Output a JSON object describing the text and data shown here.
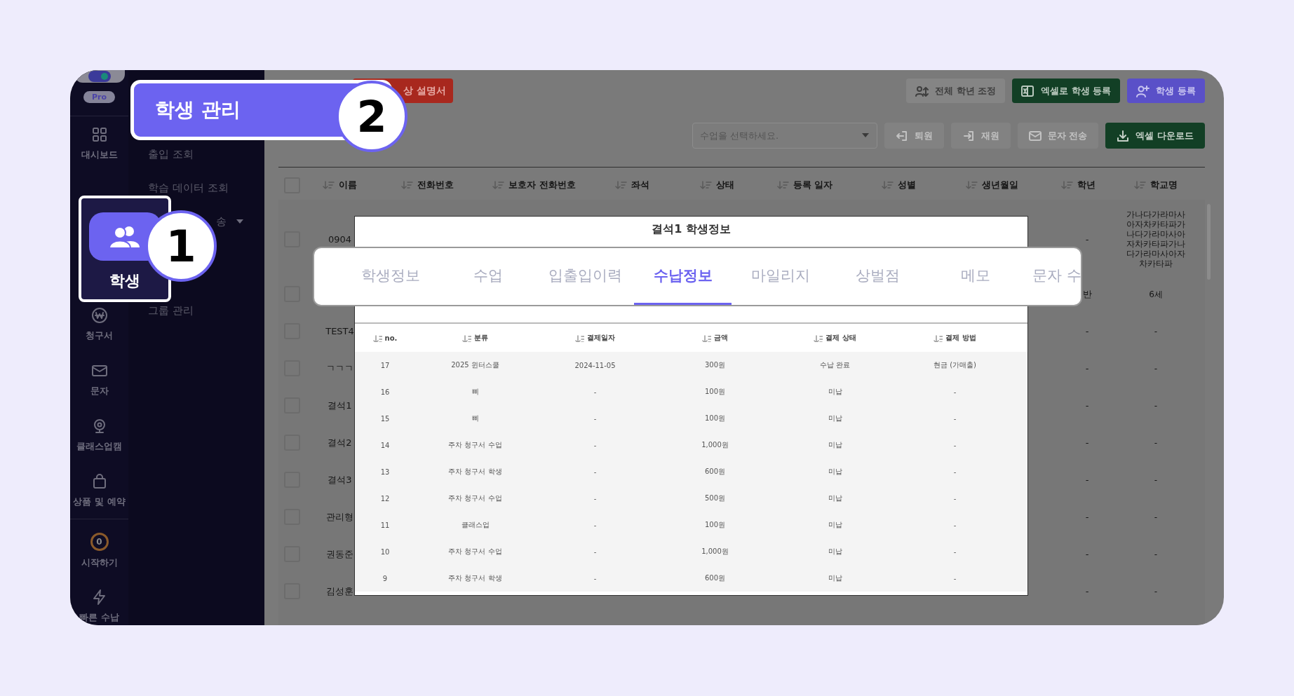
{
  "icon_sidebar": {
    "badge": "Pro",
    "items": [
      {
        "label": "대시보드",
        "kind": "grid"
      },
      {
        "label": "청구서",
        "kind": "won"
      },
      {
        "label": "문자",
        "kind": "mail"
      },
      {
        "label": "클래스업캠",
        "kind": "webcam"
      },
      {
        "label": "상품 및 예약",
        "kind": "bag"
      }
    ],
    "bottom_items": [
      {
        "label": "시작하기",
        "kind": "progress",
        "count": "0"
      },
      {
        "label": "빠른 수납",
        "kind": "bolt"
      }
    ]
  },
  "sub_sidebar": {
    "items": [
      {
        "label": "출입 조회",
        "expandable": false
      },
      {
        "label": "학습 데이터 조회",
        "expandable": false
      },
      {
        "label": "송",
        "expandable": true
      },
      {
        "label": "그룹 관리",
        "expandable": false
      }
    ]
  },
  "toolbar": {
    "guide_button": "상 설명서",
    "buttons": [
      {
        "label": "전체 학년 조정",
        "kind": "gray"
      },
      {
        "label": "엑셀로 학생 등록",
        "kind": "green"
      },
      {
        "label": "학생 등록",
        "kind": "purple"
      }
    ]
  },
  "filter_bar": {
    "class_select": {
      "placeholder": "수업을 선택하세요."
    },
    "buttons": [
      {
        "label": "퇴원",
        "disabled": true
      },
      {
        "label": "재원",
        "disabled": true
      },
      {
        "label": "문자 전송",
        "disabled": true
      },
      {
        "label": "엑셀 다운로드",
        "disabled": false
      }
    ]
  },
  "table": {
    "header_checked": false,
    "columns": [
      "이름",
      "전화번호",
      "보호자 전화번호",
      "좌석",
      "상태",
      "등록 일자",
      "성별",
      "생년월일",
      "학년",
      "학교명"
    ],
    "rows": [
      {
        "name": "0904",
        "grade": "-",
        "school": "가나다가라마사아자차카타파가나다가라마사아자차카타파가나다가라마사아자차카타파",
        "checked": false
      },
      {
        "grade": "반",
        "school": "6세",
        "checked": false
      },
      {
        "name": "TEST4",
        "grade": "-",
        "school": "-",
        "checked": false
      },
      {
        "name": "ㄱㄱㄱ",
        "grade": "-",
        "school": "-",
        "checked": false
      },
      {
        "name": "결석1",
        "grade": "-",
        "school": "-",
        "checked": false
      },
      {
        "name": "결석2",
        "grade": "-",
        "school": "-",
        "checked": false
      },
      {
        "name": "결석3",
        "grade": "-",
        "school": "-",
        "checked": false
      },
      {
        "name": "관리형",
        "grade": "-",
        "school": "-",
        "checked": false
      },
      {
        "name": "권동준",
        "grade": "-",
        "school": "-",
        "checked": false
      },
      {
        "name": "김성훈",
        "grade": "-",
        "school": "-",
        "checked": false
      }
    ]
  },
  "modal": {
    "title": "결석1 학생정보",
    "tabs": [
      {
        "label": "학생정보",
        "selected": false
      },
      {
        "label": "수업",
        "selected": false
      },
      {
        "label": "입출입이력",
        "selected": false
      },
      {
        "label": "수납정보",
        "selected": true
      },
      {
        "label": "마일리지",
        "selected": false
      },
      {
        "label": "상벌점",
        "selected": false
      },
      {
        "label": "메모",
        "selected": false
      },
      {
        "label": "문자 수",
        "selected": false
      }
    ],
    "table": {
      "columns": [
        "no.",
        "분류",
        "결제일자",
        "금액",
        "결제 상태",
        "결제 방법"
      ],
      "rows": [
        [
          "17",
          "2025 윈터스쿨",
          "2024-11-05",
          "300원",
          "수납 완료",
          "현금 (가매출)"
        ],
        [
          "16",
          "삐",
          "-",
          "100원",
          "미납",
          "-"
        ],
        [
          "15",
          "삐",
          "-",
          "100원",
          "미납",
          "-"
        ],
        [
          "14",
          "주차 청구서 수업",
          "-",
          "1,000원",
          "미납",
          "-"
        ],
        [
          "13",
          "주차 청구서 학생",
          "-",
          "600원",
          "미납",
          "-"
        ],
        [
          "12",
          "주차 청구서 수업",
          "-",
          "500원",
          "미납",
          "-"
        ],
        [
          "11",
          "클래스업",
          "-",
          "100원",
          "미납",
          "-"
        ],
        [
          "10",
          "주차 청구서 수업",
          "-",
          "1,000원",
          "미납",
          "-"
        ],
        [
          "9",
          "주차 청구서 학생",
          "-",
          "600원",
          "미납",
          "-"
        ]
      ]
    }
  },
  "callout_1": {
    "number": "1",
    "label": "학생"
  },
  "callout_2": {
    "number": "2",
    "label": "학생 관리"
  }
}
